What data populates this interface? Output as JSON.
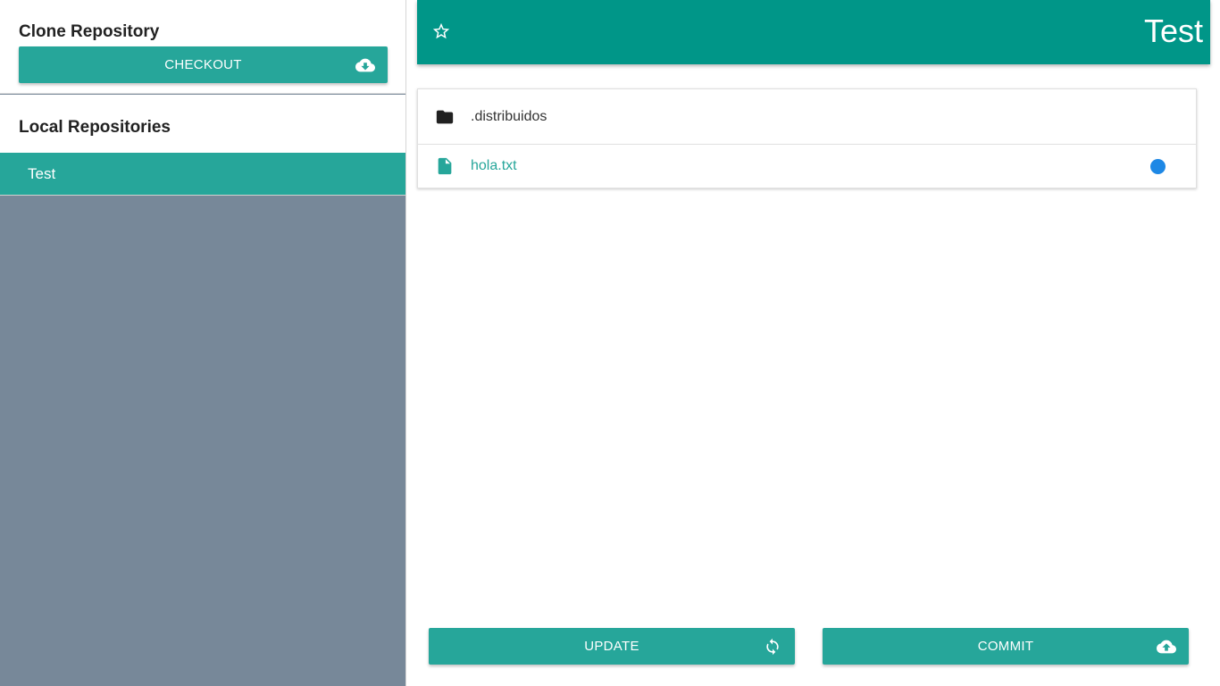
{
  "sidebar": {
    "clone_title": "Clone Repository",
    "checkout_label": "CHECKOUT",
    "checkout_icon": "cloud-download-icon",
    "local_title": "Local Repositories",
    "repositories": [
      {
        "name": "Test",
        "selected": true
      }
    ]
  },
  "header": {
    "title": "Test",
    "star_icon": "star-outline-icon"
  },
  "files": [
    {
      "name": ".distribuidos",
      "type": "folder",
      "icon": "folder-icon"
    },
    {
      "name": "hola.txt",
      "type": "file",
      "icon": "file-icon",
      "status": "modified"
    }
  ],
  "actions": {
    "update_label": "UPDATE",
    "update_icon": "sync-icon",
    "commit_label": "COMMIT",
    "commit_icon": "cloud-upload-icon"
  },
  "colors": {
    "accent": "#26a69a",
    "appbar": "#009688",
    "sidebar_bg": "#778899",
    "status_dot": "#1e88e5"
  }
}
